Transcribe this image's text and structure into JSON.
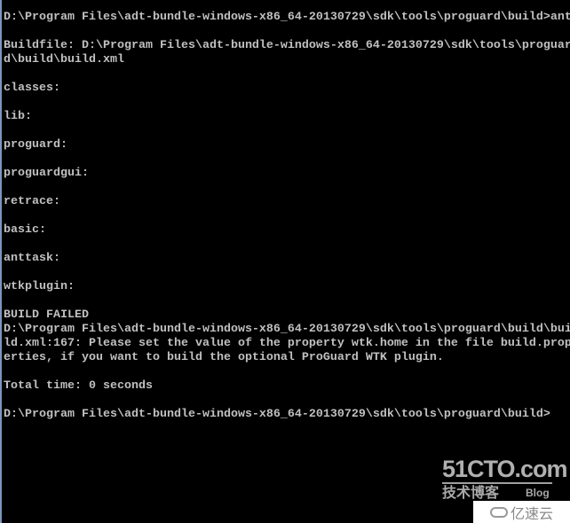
{
  "console": {
    "lines": [
      "D:\\Program Files\\adt-bundle-windows-x86_64-20130729\\sdk\\tools\\proguard\\build>ant",
      "",
      "Buildfile: D:\\Program Files\\adt-bundle-windows-x86_64-20130729\\sdk\\tools\\proguar",
      "d\\build\\build.xml",
      "",
      "classes:",
      "",
      "lib:",
      "",
      "proguard:",
      "",
      "proguardgui:",
      "",
      "retrace:",
      "",
      "basic:",
      "",
      "anttask:",
      "",
      "wtkplugin:",
      "",
      "BUILD FAILED",
      "D:\\Program Files\\adt-bundle-windows-x86_64-20130729\\sdk\\tools\\proguard\\build\\bui",
      "ld.xml:167: Please set the value of the property wtk.home in the file build.prop",
      "erties, if you want to build the optional ProGuard WTK plugin.",
      "",
      "Total time: 0 seconds",
      "",
      "D:\\Program Files\\adt-bundle-windows-x86_64-20130729\\sdk\\tools\\proguard\\build>"
    ]
  },
  "watermark": {
    "logo": "51CTO.com",
    "subtitle": "技术博客",
    "blog": "Blog",
    "yisu": "亿速云"
  },
  "colors": {
    "background": "#000000",
    "text": "#c0c0c0"
  }
}
